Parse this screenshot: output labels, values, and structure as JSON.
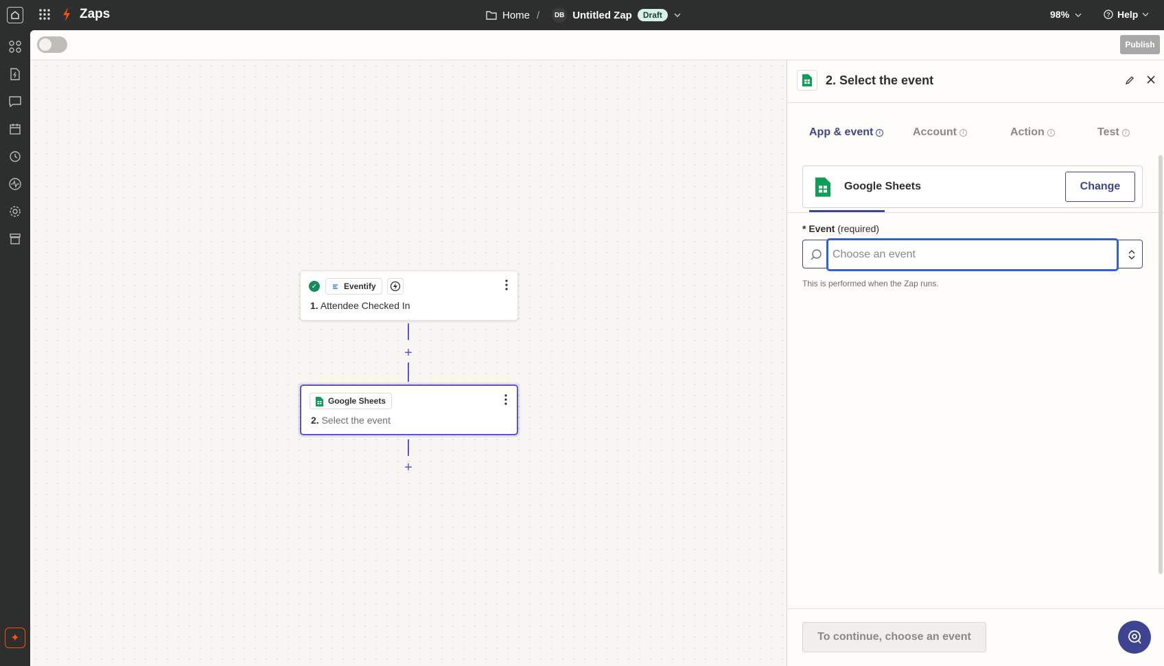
{
  "topbar": {
    "brand": "Zaps",
    "breadcrumb_home": "Home",
    "breadcrumb_sep": "/",
    "user_initials": "DB",
    "zap_name": "Untitled Zap",
    "status_badge": "Draft",
    "zoom": "98%",
    "help": "Help"
  },
  "subbar": {
    "publish_label": "Publish"
  },
  "canvas": {
    "step1": {
      "app": "Eventify",
      "number": "1.",
      "title": "Attendee Checked In"
    },
    "step2": {
      "app": "Google Sheets",
      "number": "2.",
      "title": "Select the event"
    }
  },
  "panel": {
    "title": "2. Select the event",
    "tabs": [
      {
        "label": "App & event"
      },
      {
        "label": "Account"
      },
      {
        "label": "Action"
      },
      {
        "label": "Test"
      }
    ],
    "app_name": "Google Sheets",
    "change_label": "Change",
    "event_label_star": "*",
    "event_label": "Event",
    "event_required": "(required)",
    "event_placeholder": "Choose an event",
    "helper_text": "This is performed when the Zap runs.",
    "continue_label": "To continue, choose an event"
  },
  "colors": {
    "accent": "#3d4592",
    "focus": "#2f5de3",
    "brand_orange": "#ff4f00",
    "sheets_green": "#0f9d58"
  }
}
